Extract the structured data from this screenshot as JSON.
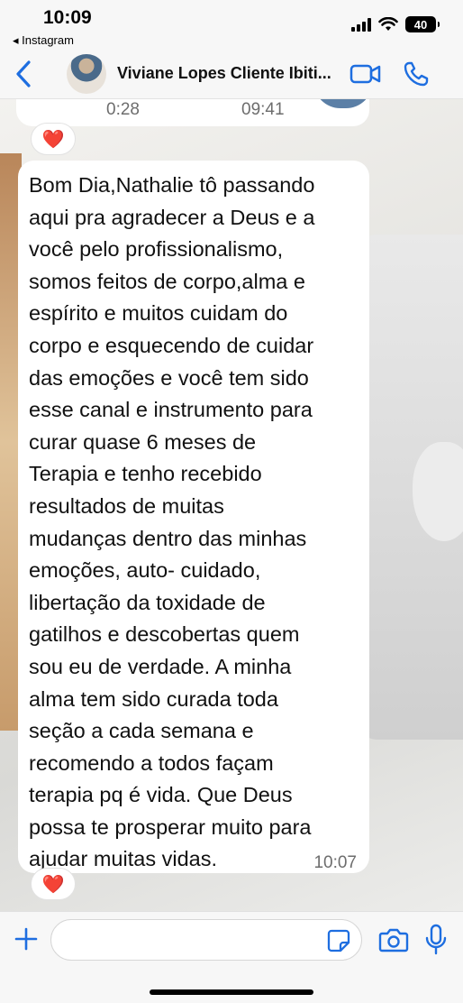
{
  "status_bar": {
    "time": "10:09",
    "back_app": "◂ Instagram",
    "battery": "40",
    "icons": [
      "cellular-signal-icon",
      "wifi-icon",
      "battery-icon"
    ]
  },
  "header": {
    "contact_name": "Viviane Lopes Cliente Ibiti...",
    "icons": [
      "back-chevron-icon",
      "video-call-icon",
      "phone-call-icon"
    ],
    "accent_color": "#1e6ee0"
  },
  "messages": {
    "previous": {
      "duration": "0:28",
      "time": "09:41"
    },
    "reaction_top": "❤️",
    "main": {
      "text": "Bom Dia,Nathalie tô passando\naqui pra agradecer a Deus e a\nvocê pelo profissionalismo,\nsomos feitos de corpo,alma e\nespírito e muitos cuidam do\ncorpo e esquecendo de cuidar\ndas emoções e você tem sido\nesse canal e instrumento para\ncurar quase 6 meses de\nTerapia e tenho recebido\nresultados de muitas\nmudanças dentro das minhas\nemoções, auto- cuidado,\nlibertação da toxidade de\ngatilhos e descobertas quem\nsou eu de verdade. A minha\nalma tem sido curada toda\nseção a cada semana e\nrecomendo a todos façam\nterapia pq é vida. Que Deus\npossa te prosperar muito para\najudar muitas vidas.",
      "time": "10:07"
    },
    "reaction_bottom": "❤️"
  },
  "input_bar": {
    "placeholder": "",
    "icons": [
      "plus-icon",
      "sticker-icon",
      "camera-icon",
      "microphone-icon"
    ]
  }
}
